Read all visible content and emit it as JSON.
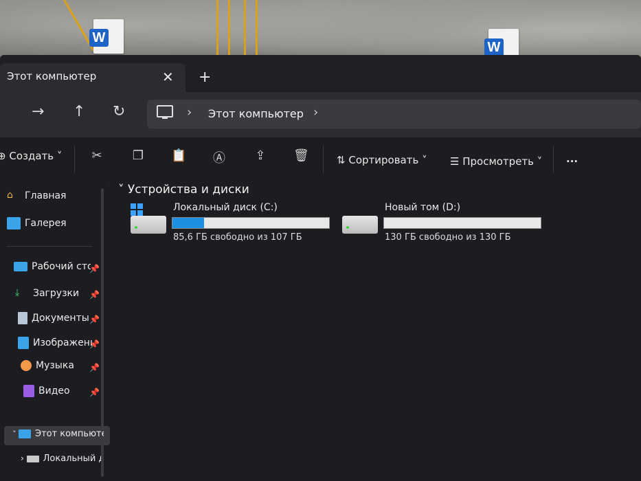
{
  "tab": {
    "title": "Этот компьютер",
    "close": "✕",
    "new": "+"
  },
  "nav": {
    "back": "←",
    "forward": "→",
    "up": "↑",
    "refresh": "↻"
  },
  "address": {
    "sep1": "›",
    "crumb": "Этот компьютер",
    "sep2": "›"
  },
  "toolbar": {
    "create": "Создать",
    "sort": "Сортировать",
    "view": "Просмотреть",
    "more": "..."
  },
  "sidebar": {
    "items": [
      {
        "label": "Главная",
        "icon": "home-icon"
      },
      {
        "label": "Галерея",
        "icon": "gallery-icon"
      },
      {
        "label": "Рабочий стол",
        "icon": "desktop-icon"
      },
      {
        "label": "Загрузки",
        "icon": "download-icon"
      },
      {
        "label": "Документы",
        "icon": "documents-icon"
      },
      {
        "label": "Изображения",
        "icon": "pictures-icon"
      },
      {
        "label": "Музыка",
        "icon": "music-icon"
      },
      {
        "label": "Видео",
        "icon": "video-icon"
      },
      {
        "label": "Этот компьютер",
        "icon": "computer-icon"
      },
      {
        "label": "Локальный диск (C:)",
        "icon": "drive-icon"
      }
    ]
  },
  "main": {
    "section_title": "Устройства и диски",
    "drives": [
      {
        "name": "Локальный диск (C:)",
        "free_text": "85,6 ГБ свободно из 107 ГБ",
        "used_fraction": 0.2
      },
      {
        "name": "Новый том (D:)",
        "free_text": "130 ГБ свободно из 130 ГБ",
        "used_fraction": 0.0
      }
    ]
  },
  "desktop": {
    "word_icon_letter": "W"
  },
  "colors": {
    "accent": "#1f8fdf",
    "window_bg": "#1c1d20",
    "toolbar_bg": "#2b2c30"
  }
}
